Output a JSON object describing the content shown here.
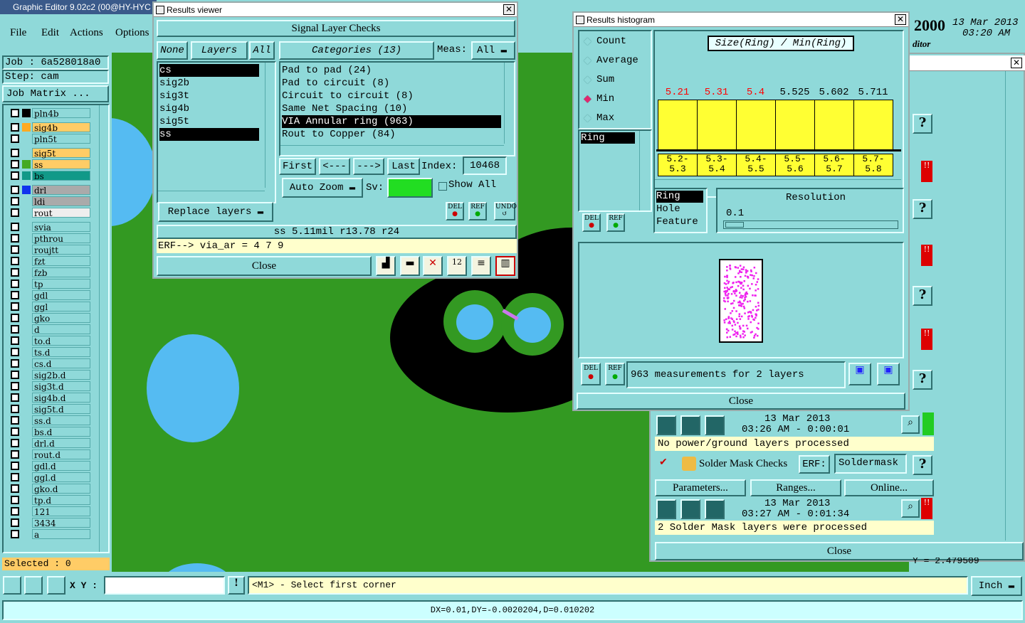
{
  "app": {
    "title": "Graphic Editor 9.02c2 (00@HY-HYC",
    "menu": [
      "File",
      "Edit",
      "Actions",
      "Options"
    ],
    "clock": {
      "year": "2000",
      "date": "13 Mar 2013",
      "time": "03:20 AM"
    },
    "editor_fragment": "ditor"
  },
  "job": {
    "job": "Job : 6a528018a0",
    "step": "Step: cam",
    "matrix_btn": "Job Matrix ..."
  },
  "layers": [
    "pln4b",
    "sig4b",
    "pln5t",
    "sig5t",
    "ss",
    "bs",
    "drl",
    "ldi",
    "rout",
    "svia",
    "pthrou",
    "roujtt",
    "fzt",
    "fzb",
    "tp",
    "gdl",
    "ggl",
    "gko",
    "d",
    "to.d",
    "ts.d",
    "cs.d",
    "sig2b.d",
    "sig3t.d",
    "sig4b.d",
    "sig5t.d",
    "ss.d",
    "bs.d",
    "drl.d",
    "rout.d",
    "gdl.d",
    "ggl.d",
    "gko.d",
    "tp.d",
    "121",
    "3434",
    "a"
  ],
  "selected": "Selected : 0",
  "bottom": {
    "xy_label": "X Y :",
    "hint": "<M1> - Select first corner",
    "units": "Inch",
    "status": "DX=0.01,DY=-0.0020204,D=0.010202"
  },
  "results": {
    "title": "Results viewer",
    "header": "Signal Layer Checks",
    "none": "None",
    "layers_lbl": "Layers",
    "all": "All",
    "categories_lbl": "Categories (13)",
    "meas_lbl": "Meas:",
    "meas_val": "All",
    "layer_list": [
      "cs",
      "sig2b",
      "sig3t",
      "sig4b",
      "sig5t",
      "ss"
    ],
    "categories": [
      "Pad to pad (24)",
      "Pad to circuit (8)",
      "Circuit to circuit (8)",
      "Same Net Spacing (10)",
      "VIA Annular ring (963)",
      "Rout to Copper (84)"
    ],
    "first": "First",
    "prev": "<---",
    "next": "--->",
    "last": "Last",
    "index_lbl": "Index:",
    "index_val": "10468",
    "auto_zoom": "Auto Zoom",
    "sv": "Sv:",
    "show_all": "Show All",
    "replace": "Replace layers",
    "del": "DEL",
    "ref": "REF",
    "undo": "UNDO",
    "info": "ss 5.11mil   r13.78   r24",
    "erf": "ERF--> via_ar = 4 7 9",
    "close": "Close"
  },
  "histogram": {
    "title": "Results histogram",
    "stats": [
      "Count",
      "Average",
      "Sum",
      "Min",
      "Max"
    ],
    "selected_stat": "Min",
    "chart_title": "Size(Ring) / Min(Ring)",
    "ring": "Ring",
    "del": "DEL",
    "ref": "REF",
    "bar_values": [
      "5.21",
      "5.31",
      "5.4",
      "5.525",
      "5.602",
      "5.711"
    ],
    "bar_colors": [
      "#ff0000",
      "#ff0000",
      "#ff0000",
      "#000000",
      "#000000",
      "#000000"
    ],
    "ranges": [
      [
        "5.2-",
        "5.3"
      ],
      [
        "5.3-",
        "5.4"
      ],
      [
        "5.4-",
        "5.5"
      ],
      [
        "5.5-",
        "5.6"
      ],
      [
        "5.6-",
        "5.7"
      ],
      [
        "5.7-",
        "5.8"
      ]
    ],
    "types": [
      "Ring",
      "Hole",
      "Feature"
    ],
    "resolution_lbl": "Resolution",
    "resolution_val": "0.1",
    "summary": "963 measurements for 2 layers",
    "close": "Close"
  },
  "checklist": {
    "run1_date": "13 Mar 2013",
    "run1_time": "03:26 AM - 0:00:01",
    "run1_msg": "No power/ground layers processed",
    "solder_name": "Solder Mask Checks",
    "erf": "ERF:",
    "erf_val": "Soldermask",
    "params": "Parameters...",
    "ranges": "Ranges...",
    "online": "Online...",
    "run2_date": "13 Mar 2013",
    "run2_time": "03:27 AM - 0:01:34",
    "run2_msg": "2 Solder Mask layers were processed",
    "close": "Close",
    "coord_fragment": "Y = 2.479509"
  }
}
